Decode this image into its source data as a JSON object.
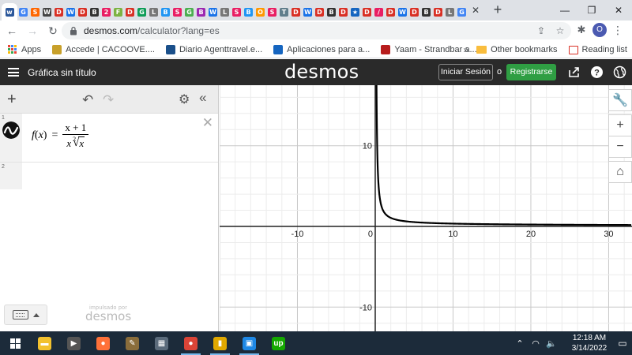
{
  "browser": {
    "tabs": [
      {
        "glyph": "w",
        "color": "#2b579a"
      },
      {
        "glyph": "G",
        "color": "#4285f4"
      },
      {
        "glyph": "S",
        "color": "#ff6600"
      },
      {
        "glyph": "W",
        "color": "#444444"
      },
      {
        "glyph": "D",
        "color": "#d93025"
      },
      {
        "glyph": "W",
        "color": "#1a73e8"
      },
      {
        "glyph": "D",
        "color": "#d93025"
      },
      {
        "glyph": "B",
        "color": "#333333"
      },
      {
        "glyph": "2",
        "color": "#e91e63"
      },
      {
        "glyph": "F",
        "color": "#7cb342"
      },
      {
        "glyph": "D",
        "color": "#d93025"
      },
      {
        "glyph": "G",
        "color": "#0f9d58"
      },
      {
        "glyph": "L",
        "color": "#777777"
      },
      {
        "glyph": "B",
        "color": "#2196f3"
      },
      {
        "glyph": "S",
        "color": "#e91e63"
      },
      {
        "glyph": "G",
        "color": "#4caf50"
      },
      {
        "glyph": "B",
        "color": "#9c27b0"
      },
      {
        "glyph": "W",
        "color": "#1a73e8"
      },
      {
        "glyph": "L",
        "color": "#777777"
      },
      {
        "glyph": "S",
        "color": "#e91e63"
      },
      {
        "glyph": "B",
        "color": "#2196f3"
      },
      {
        "glyph": "O",
        "color": "#ff9800"
      },
      {
        "glyph": "S",
        "color": "#e91e63"
      },
      {
        "glyph": "T",
        "color": "#607d8b"
      },
      {
        "glyph": "D",
        "color": "#d93025"
      },
      {
        "glyph": "W",
        "color": "#1a73e8"
      },
      {
        "glyph": "D",
        "color": "#d93025"
      },
      {
        "glyph": "B",
        "color": "#333333"
      },
      {
        "glyph": "D",
        "color": "#d93025"
      },
      {
        "glyph": "★",
        "color": "#1565c0"
      },
      {
        "glyph": "D",
        "color": "#d93025"
      },
      {
        "glyph": "/",
        "color": "#e91e63"
      },
      {
        "glyph": "D",
        "color": "#d93025"
      },
      {
        "glyph": "W",
        "color": "#1a73e8"
      },
      {
        "glyph": "D",
        "color": "#d93025"
      },
      {
        "glyph": "B",
        "color": "#333333"
      },
      {
        "glyph": "D",
        "color": "#d93025"
      },
      {
        "glyph": "L",
        "color": "#777777"
      },
      {
        "glyph": "G",
        "color": "#4285f4"
      }
    ],
    "url_host": "desmos.com",
    "url_path": "/calculator?lang=es",
    "profile_initial": "O",
    "bookmarks": {
      "apps": "Apps",
      "items": [
        {
          "label": "Accede | CACOOVE....",
          "color": "#c8a02a"
        },
        {
          "label": "Diario Agenttravel.e...",
          "color": "#1a4f8a"
        },
        {
          "label": "Aplicaciones para a...",
          "color": "#1565c0"
        },
        {
          "label": "Yaam - Strandbar a...",
          "color": "#b71c1c"
        }
      ],
      "other": "Other bookmarks",
      "reading_list": "Reading list"
    }
  },
  "desmos": {
    "graph_title": "Gráfica sin título",
    "logo": "desmos",
    "signin_label": "Iniciar Sesión",
    "or_label": "o",
    "register_label": "Registrarse",
    "brand_green": "#2f9e43",
    "expressions": [
      {
        "row": "1",
        "fname": "f",
        "var": "x",
        "numerator": "x + 1",
        "den_var": "x",
        "root_index": "2",
        "radicand": "x"
      },
      {
        "row": "2"
      }
    ],
    "powered_small": "impulsado por",
    "powered_big": "desmos"
  },
  "chart_data": {
    "type": "line",
    "function": "f(x) = (x + 1) / (x · √x)",
    "x_ticks": [
      "-10",
      "0",
      "10",
      "20",
      "30"
    ],
    "y_ticks": [
      "10",
      "-10"
    ],
    "xlim": [
      -20,
      33
    ],
    "ylim": [
      -13,
      17.5
    ],
    "grid": true,
    "curve_color": "#000000"
  },
  "taskbar": {
    "time": "12:18 AM",
    "date": "3/14/2022",
    "apps": [
      {
        "glyph": "▬",
        "color": "#f2c12e",
        "active": false
      },
      {
        "glyph": "▶",
        "color": "#555555",
        "active": false
      },
      {
        "glyph": "●",
        "color": "#ff7139",
        "active": false
      },
      {
        "glyph": "✎",
        "color": "#8a6d3b",
        "active": false
      },
      {
        "glyph": "▦",
        "color": "#5b6b7b",
        "active": false
      },
      {
        "glyph": "●",
        "color": "#db4437",
        "active": true
      },
      {
        "glyph": "▮",
        "color": "#e0a800",
        "active": true
      },
      {
        "glyph": "▣",
        "color": "#1e88e5",
        "active": true
      },
      {
        "glyph": "up",
        "color": "#14a800",
        "active": false
      }
    ]
  }
}
